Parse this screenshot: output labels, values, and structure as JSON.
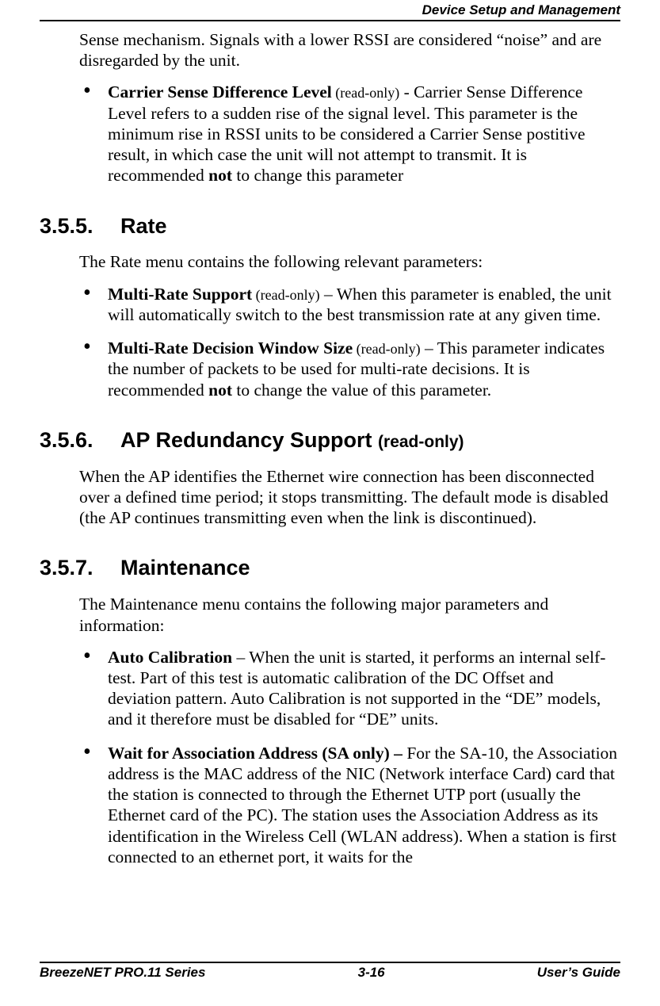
{
  "header": {
    "title": "Device Setup and Management"
  },
  "continued": {
    "text": "Sense mechanism. Signals with a lower RSSI are considered “noise” and are disregarded by the unit."
  },
  "bullet_csdl": {
    "title": "Carrier Sense Difference Level",
    "annot": " (read-only)",
    "sep": " - ",
    "body_a": "Carrier Sense Difference Level refers to a sudden rise of the signal level. This parameter is the minimum rise in RSSI units to be considered a Carrier Sense postitive result, in which case the unit will not attempt to transmit. It is recommended ",
    "not": "not",
    "body_b": " to change this parameter"
  },
  "sec_rate": {
    "num": "3.5.5.",
    "title": "Rate",
    "intro": "The Rate menu contains the following relevant parameters:"
  },
  "bullet_mrs": {
    "title": "Multi-Rate Support",
    "annot": " (read-only)",
    "sep": " – ",
    "body": "When this parameter is enabled, the unit will automatically switch to the best transmission rate at any given time."
  },
  "bullet_mrdw": {
    "title": "Multi-Rate Decision Window Size",
    "annot": " (read-only)",
    "sep": " – ",
    "body_a": "This parameter indicates the number of packets to be used for multi-rate decisions. It is recommended ",
    "not": "not",
    "body_b": " to change the value of this parameter."
  },
  "sec_apred": {
    "num": "3.5.6.",
    "title": "AP Redundancy Support ",
    "annot": "(read-only)",
    "body": "When the AP identifies the Ethernet wire connection has been disconnected over a defined time period; it stops transmitting. The default mode is disabled (the AP continues transmitting even when the link is discontinued)."
  },
  "sec_maint": {
    "num": "3.5.7.",
    "title": "Maintenance",
    "intro": "The Maintenance menu contains the following major parameters and information:"
  },
  "bullet_auto": {
    "title": "Auto Calibration",
    "sep": "  – ",
    "body": "When the unit is started, it performs an internal self-test. Part of this test is automatic calibration of the DC Offset and deviation pattern. Auto Calibration is not supported in the “DE” models, and it therefore must be disabled for “DE” units."
  },
  "bullet_wfa": {
    "title": "Wait for Association Address  (SA only) – ",
    "body": "For the SA-10, the Association address is the MAC address of the NIC (Network interface Card) card that the station is connected to through the Ethernet UTP port (usually the Ethernet card of the PC). The station uses the Association Address as its identification in the Wireless Cell (WLAN address). When a station is first connected to an ethernet port, it waits for the"
  },
  "footer": {
    "left": "BreezeNET PRO.11 Series",
    "center": "3-16",
    "right": "User’s Guide"
  }
}
